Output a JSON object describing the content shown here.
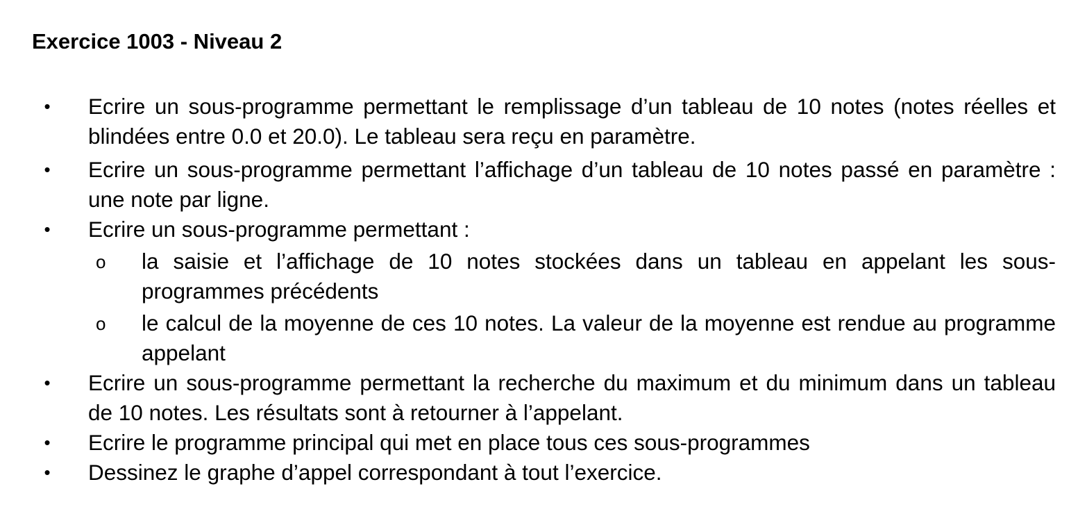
{
  "title": "Exercice 1003 - Niveau 2",
  "bullet_glyph": "•",
  "sub_bullet_glyph": "o",
  "items": [
    {
      "text": "Ecrire un sous-programme permettant le remplissage d’un tableau de 10 notes (notes réelles et blindées entre 0.0 et 20.0). Le tableau sera reçu en paramètre."
    },
    {
      "text": "Ecrire un sous-programme permettant l’affichage d’un tableau de 10 notes passé en paramètre : une note par ligne."
    },
    {
      "text": "Ecrire un sous-programme permettant :",
      "sub_items": [
        "la saisie et l’affichage de 10 notes stockées dans un tableau en appelant les sous-programmes précédents",
        "le calcul de la moyenne de ces 10 notes. La valeur de la moyenne est rendue au programme appelant"
      ]
    },
    {
      "text": "Ecrire un sous-programme permettant la recherche du maximum et du minimum dans un tableau de 10 notes. Les résultats sont à retourner à l’appelant."
    },
    {
      "text": "Ecrire le programme principal qui met en place tous ces sous-programmes"
    },
    {
      "text": "Dessinez le graphe d’appel correspondant à tout l’exercice."
    }
  ]
}
